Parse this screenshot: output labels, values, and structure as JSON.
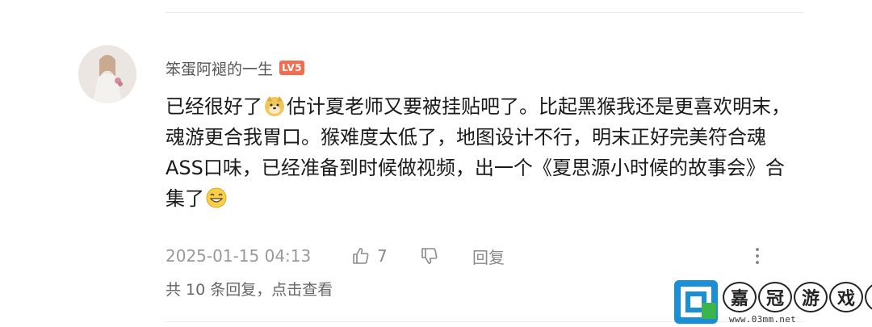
{
  "comment": {
    "author": "笨蛋阿褪的一生",
    "level_badge": "LV5",
    "text_part1": "已经很好了",
    "text_part2": "估计夏老师又要被挂贴吧了。比起黑猴我还是更喜欢明末，魂游更合我胃口。猴难度太低了，地图设计不行，明末正好完美符合魂ASS口味，已经准备到时候做视频，出一个《夏思源小时候的故事会》合集了",
    "timestamp": "2025-01-15 04:13",
    "like_count": "7",
    "reply_label": "回复",
    "replies_link": "共 10 条回复，点击查看"
  },
  "watermark": {
    "chars": [
      "嘉",
      "冠",
      "游",
      "戏",
      "网"
    ],
    "url": "www.03mm.net"
  },
  "colors": {
    "badge": "#f26c4f",
    "text": "#1a1a1a",
    "muted": "#999999"
  }
}
